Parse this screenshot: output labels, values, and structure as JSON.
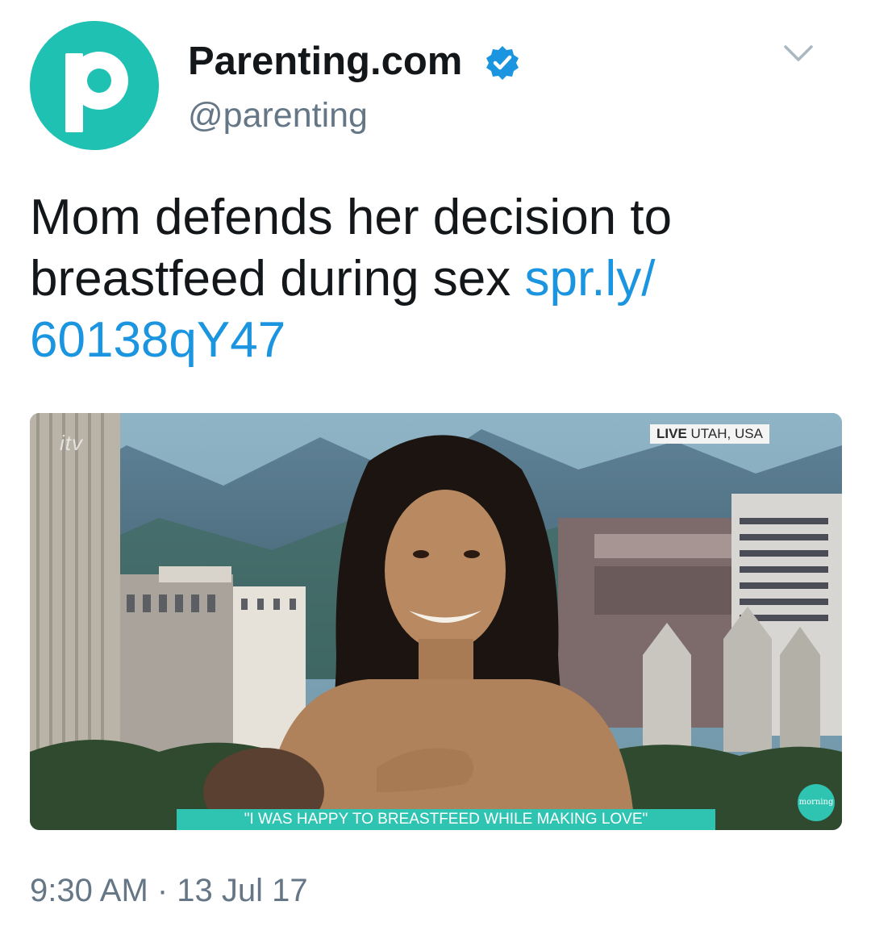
{
  "author": {
    "display_name": "Parenting.com",
    "handle": "@parenting",
    "avatar_letter": "p",
    "avatar_color": "#1fc1b3",
    "verified": true,
    "verified_color": "#1b95e0"
  },
  "menu": {
    "icon": "chevron-down-icon"
  },
  "tweet": {
    "text": "Mom defends her decision to breastfeed during sex ",
    "link_text": "spr.ly/ 60138qY47",
    "link_color": "#1b95e0"
  },
  "media": {
    "network_logo": "itv",
    "live_badge_bold": "LIVE",
    "live_badge_location": " UTAH, USA",
    "caption": "\"I WAS HAPPY TO BREASTFEED WHILE MAKING LOVE\"",
    "caption_color": "#2fc4b2",
    "show_logo": "morning"
  },
  "timestamp": "9:30 AM · 13 Jul 17"
}
